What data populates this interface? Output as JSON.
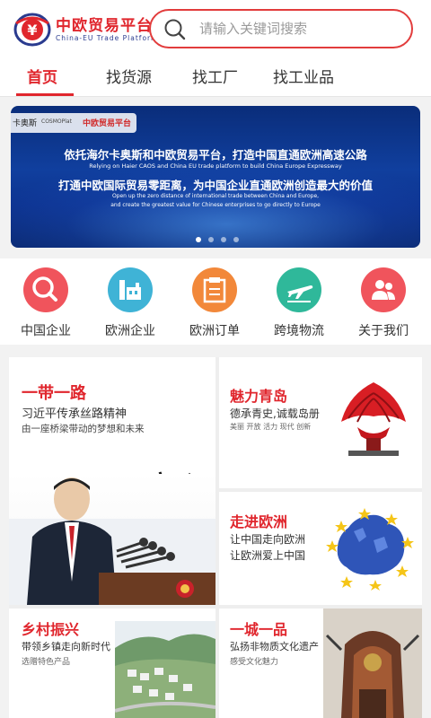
{
  "header": {
    "logo_title": "中欧贸易平台",
    "logo_subtitle": "China-EU  Trade  Platform",
    "logo_icon": "yen-globe-logo",
    "search": {
      "placeholder": "请输入关键词搜索",
      "icon": "search-icon"
    }
  },
  "tabs": [
    {
      "label": "首页",
      "active": true
    },
    {
      "label": "找货源",
      "active": false
    },
    {
      "label": "找工厂",
      "active": false
    },
    {
      "label": "找工业品",
      "active": false
    }
  ],
  "banner": {
    "brand_left": "卡奥斯",
    "brand_cosmo": "COSMOPlat",
    "brand_platform": "中欧贸易平台",
    "headline1": "依托海尔卡奥斯和中欧贸易平台，打造中国直通欧洲高速公路",
    "english1": "Relying on Haier CAOS and China EU trade platform to build China Europe Expressway",
    "headline2": "打通中欧国际贸易零距离，为中国企业直通欧洲创造最大的价值",
    "english2": "Open up the zero distance of international trade between China and Europe,",
    "english3": "and create the greatest value for Chinese enterprises to go directly to Europe",
    "slide_count": 4,
    "active_slide": 1
  },
  "quick_nav": [
    {
      "label": "中国企业",
      "icon": "magnifier-icon",
      "color": "#f0545c"
    },
    {
      "label": "欧洲企业",
      "icon": "factory-icon",
      "color": "#3fb3d6"
    },
    {
      "label": "欧洲订单",
      "icon": "order-icon",
      "color": "#f2883a"
    },
    {
      "label": "跨境物流",
      "icon": "airplane-icon",
      "color": "#2fb89a"
    },
    {
      "label": "关于我们",
      "icon": "people-icon",
      "color": "#f0545c"
    }
  ],
  "features": {
    "belt_road": {
      "title": "一带一路",
      "line1": "习近平传承丝路精神",
      "line2": "由一座桥梁带动的梦想和未来",
      "art_text": "一带一路"
    },
    "qingdao": {
      "title": "魅力青岛",
      "line1": "德承青史,诚载岛册",
      "tags": "美丽  开放  活力  现代  创新"
    },
    "europe": {
      "title": "走进欧洲",
      "line1": "让中国走向欧洲",
      "line2": "让欧洲爱上中国"
    },
    "rural": {
      "title": "乡村振兴",
      "line1": "带领乡镇走向新时代",
      "tags": "选赠特色产品"
    },
    "city": {
      "title": "一城一品",
      "line1": "弘扬非物质文化遗产",
      "tags": "感受文化魅力"
    }
  },
  "colors": {
    "brand_red": "#e0262d",
    "banner_blue": "#0d3390"
  }
}
